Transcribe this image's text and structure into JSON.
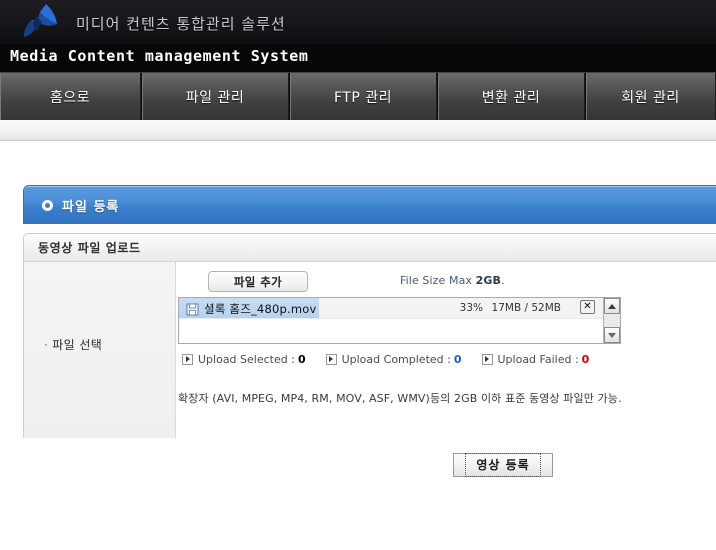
{
  "brand": {
    "korean_tagline": "미디어 컨텐츠 통합관리 솔루션",
    "english_title": "Media Content management System",
    "logo_icon": "butterfly-logo-icon"
  },
  "nav": {
    "items": [
      {
        "label": "홈으로",
        "name": "home"
      },
      {
        "label": "파일 관리",
        "name": "file-management"
      },
      {
        "label": "FTP 관리",
        "name": "ftp-management"
      },
      {
        "label": "변환 관리",
        "name": "conversion-management"
      },
      {
        "label": "회원 관리",
        "name": "member-management"
      }
    ]
  },
  "section": {
    "title": "파일 등록",
    "bullet_icon": "radio-dot-icon",
    "accent_color": "#3a7ecb"
  },
  "panel": {
    "header": "동영상 파일 업로드",
    "left_label": "파일 선택",
    "left_bullet": "·"
  },
  "upload": {
    "add_button": "파일 추가",
    "max_size_prefix": "File Size Max ",
    "max_size_value": "2GB",
    "max_size_suffix": ".",
    "file": {
      "icon": "file-document-icon",
      "name": "셜록 홈즈_480p.mov",
      "percent": "33%",
      "progress_value": 33,
      "size": "17MB / 52MB",
      "delete_icon": "close-x-icon",
      "delete_label": "✕"
    },
    "scrollbar": {
      "up_icon": "scroll-up-arrow-icon",
      "down_icon": "scroll-down-arrow-icon"
    },
    "stats": [
      {
        "label": "Upload Selected :",
        "value": "0",
        "color": "#000000",
        "icon": "play-triangle-icon"
      },
      {
        "label": "Upload Completed :",
        "value": "0",
        "color": "#1a5fd0",
        "icon": "play-triangle-icon"
      },
      {
        "label": "Upload Failed :",
        "value": "0",
        "color": "#d40000",
        "icon": "play-triangle-icon"
      }
    ],
    "note": "확장자 (AVI, MPEG, MP4, RM, MOV, ASF, WMV)등의 2GB 이하 표준 동영상 파일만 가능."
  },
  "actions": {
    "submit_label": "영상 등록"
  }
}
